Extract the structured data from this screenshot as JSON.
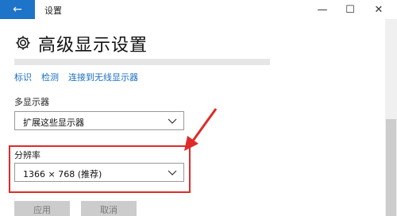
{
  "titlebar": {
    "app_title": "设置",
    "back_icon": "←",
    "minimize_icon": "—",
    "maximize_icon": "☐",
    "close_icon": "✕",
    "accent_color": "#1d74c9"
  },
  "page": {
    "title": "高级显示设置",
    "icon": "gear-icon"
  },
  "links": [
    "标识",
    "检测",
    "连接到无线显示器"
  ],
  "multi_display": {
    "label": "多显示器",
    "selected": "扩展这些显示器"
  },
  "resolution": {
    "label": "分辨率",
    "selected": "1366 × 768 (推荐)"
  },
  "buttons": {
    "apply": "应用",
    "cancel": "取消"
  },
  "annotation": {
    "color": "#e02a2a"
  }
}
